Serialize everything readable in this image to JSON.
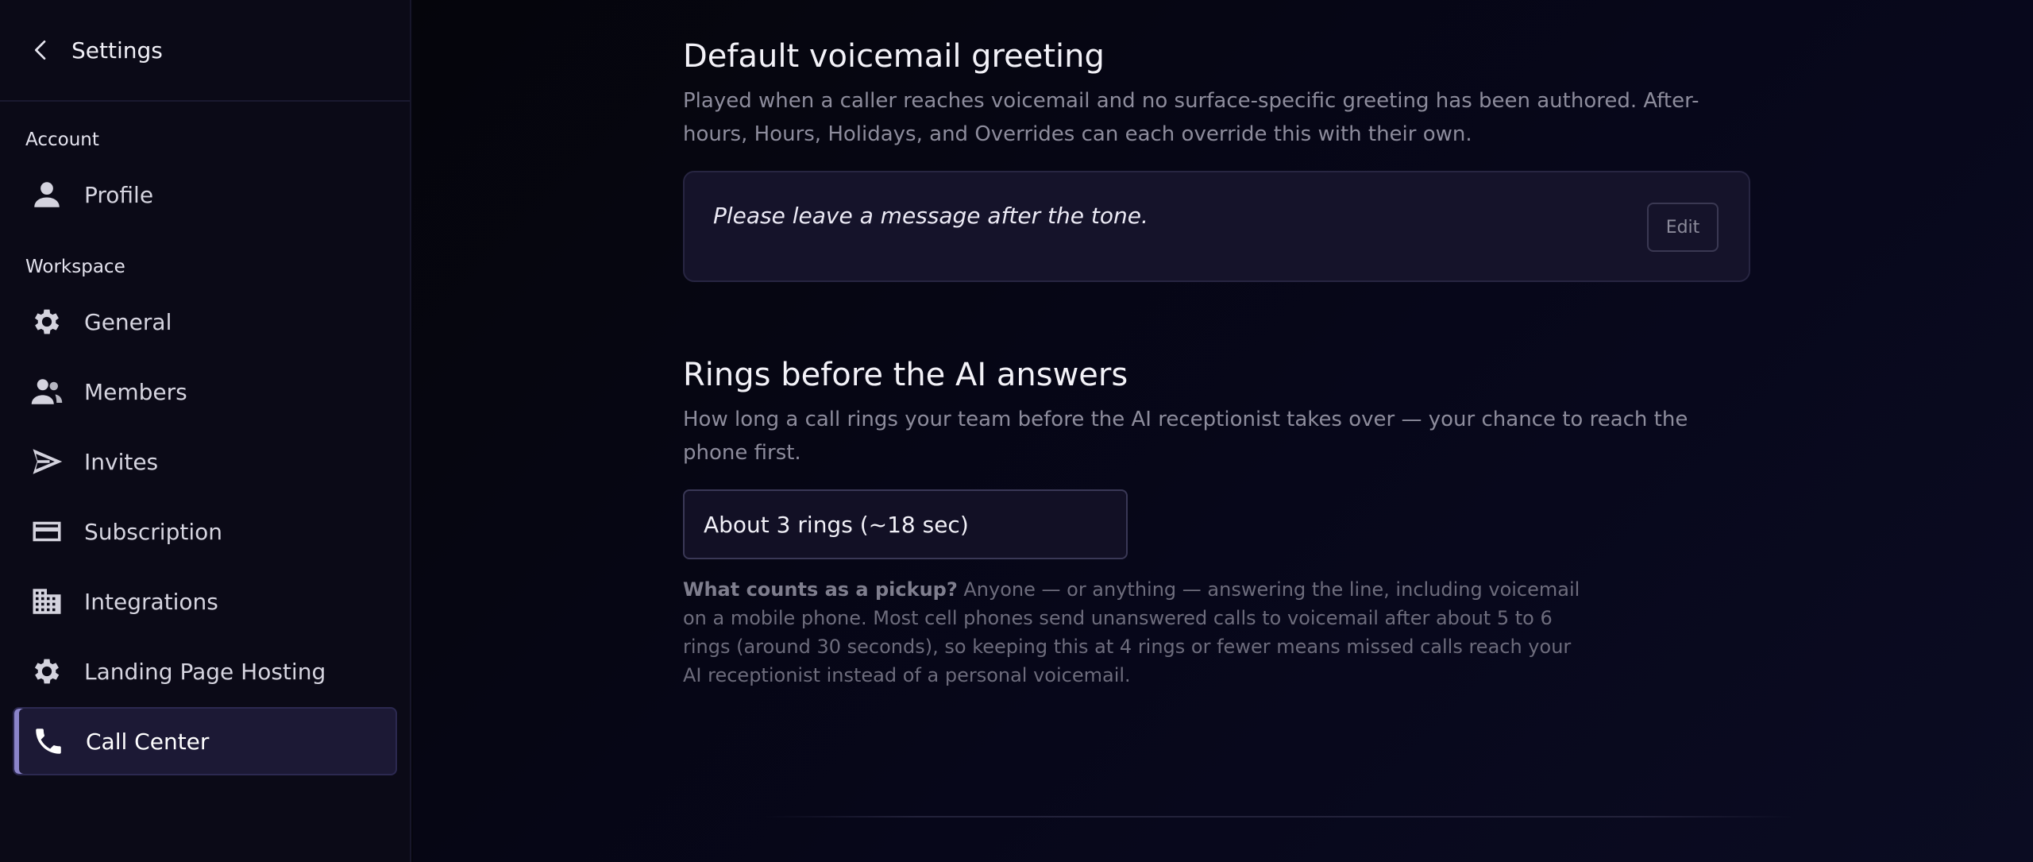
{
  "sidebar": {
    "title": "Settings",
    "sections": {
      "account": "Account",
      "workspace": "Workspace"
    },
    "items": [
      {
        "label": "Profile",
        "icon": "user-icon"
      },
      {
        "label": "General",
        "icon": "gear-icon"
      },
      {
        "label": "Members",
        "icon": "users-icon"
      },
      {
        "label": "Invites",
        "icon": "send-icon"
      },
      {
        "label": "Subscription",
        "icon": "credit-card-icon"
      },
      {
        "label": "Integrations",
        "icon": "building-icon"
      },
      {
        "label": "Landing Page Hosting",
        "icon": "gear-icon"
      },
      {
        "label": "Call Center",
        "icon": "phone-icon",
        "active": true
      }
    ]
  },
  "voicemail": {
    "title": "Default voicemail greeting",
    "description": "Played when a caller reaches voicemail and no surface-specific greeting has been authored. After-hours, Hours, Holidays, and Overrides can each override this with their own.",
    "greeting": "Please leave a message after the tone.",
    "edit_label": "Edit"
  },
  "rings": {
    "title": "Rings before the AI answers",
    "description": "How long a call rings your team before the AI receptionist takes over — your chance to reach the phone first.",
    "selected": "About 3 rings (~18 sec)",
    "note_bold": "What counts as a pickup?",
    "note_text": " Anyone — or anything — answering the line, including voicemail on a mobile phone. Most cell phones send unanswered calls to voicemail after about 5 to 6 rings (around 30 seconds), so keeping this at 4 rings or fewer means missed calls reach your AI receptionist instead of a personal voicemail."
  },
  "colors": {
    "accent": "#8b84c9",
    "active_bg": "#1c1935",
    "background": "#05050d"
  }
}
